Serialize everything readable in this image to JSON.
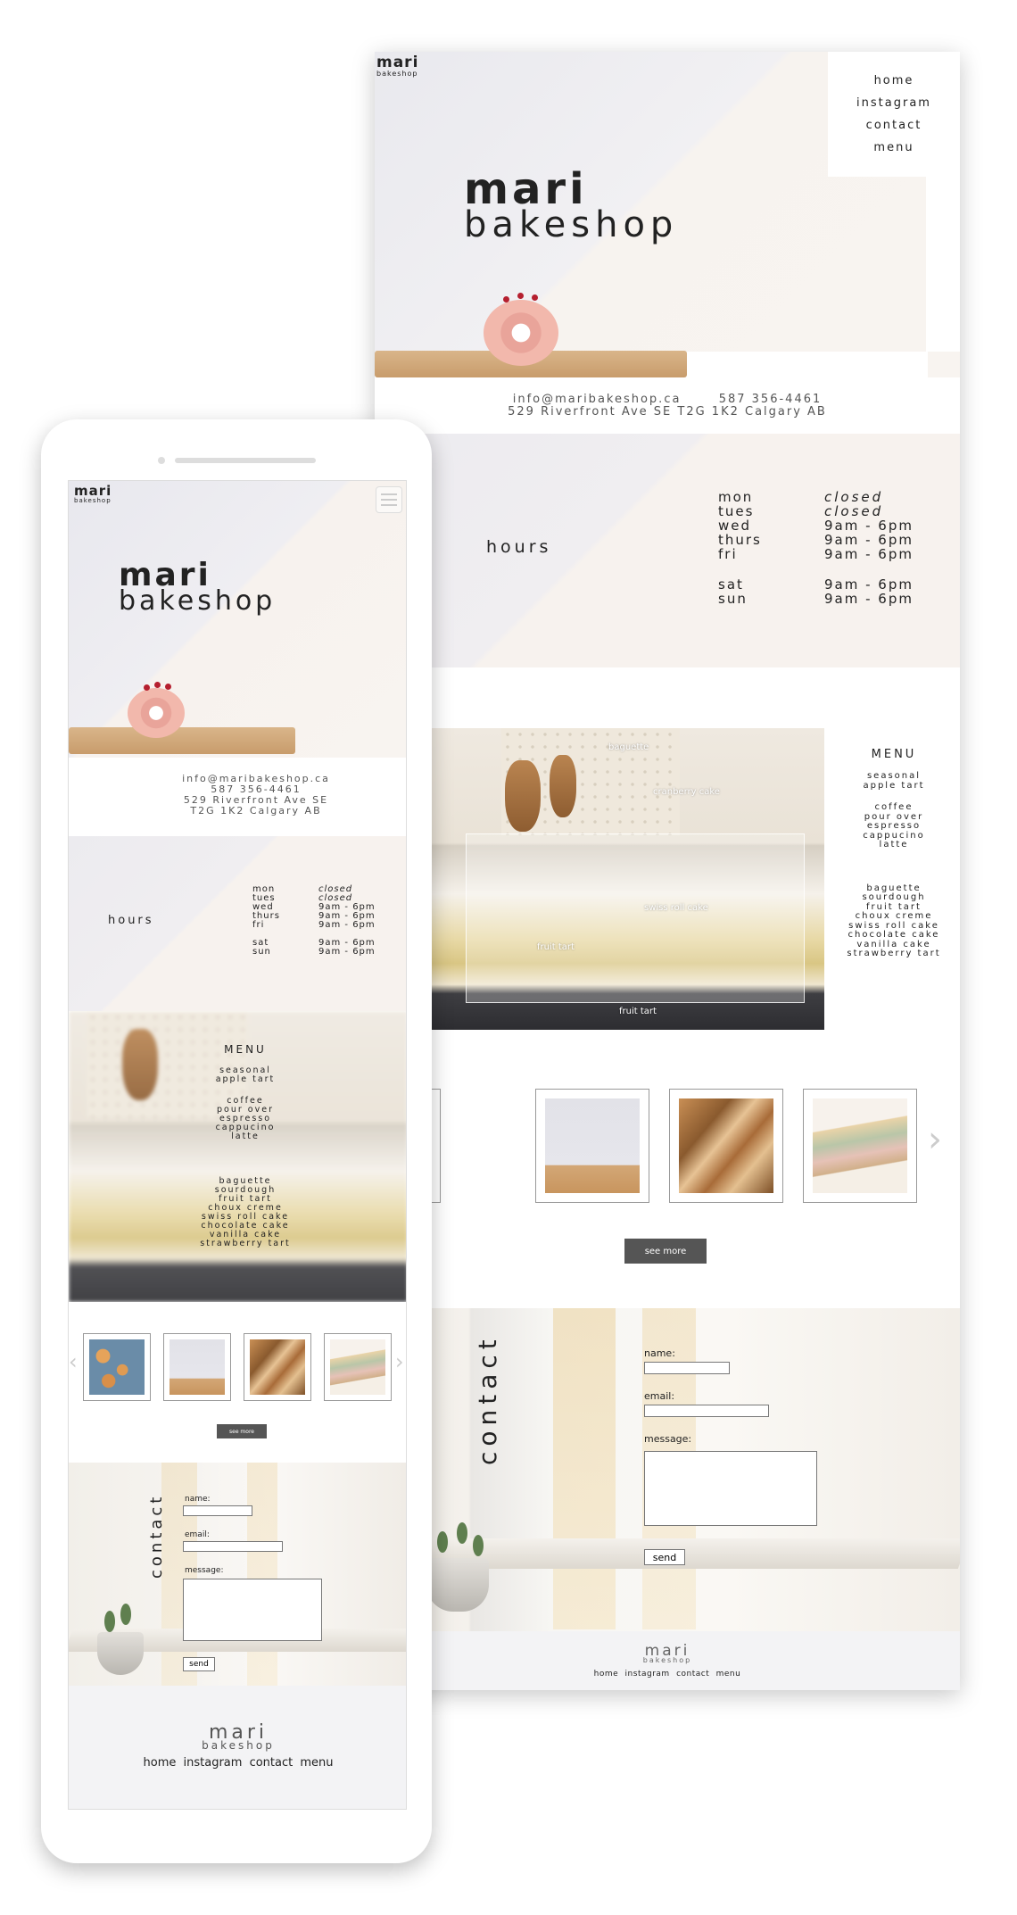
{
  "brand": {
    "name_top": "mari",
    "name_bottom": "bakeshop"
  },
  "nav": [
    "home",
    "instagram",
    "contact",
    "menu"
  ],
  "contact_info": {
    "email": "info@maribakeshop.ca",
    "phone": "587 356-4461",
    "address": "529 Riverfront Ave SE T2G 1K2 Calgary AB",
    "address_line1": "529 Riverfront Ave SE",
    "address_line2": "T2G 1K2 Calgary AB"
  },
  "hours": {
    "title": "hours",
    "rows": [
      {
        "day": "mon",
        "time": "closed"
      },
      {
        "day": "tues",
        "time": "closed"
      },
      {
        "day": "wed",
        "time": "9am - 6pm"
      },
      {
        "day": "thurs",
        "time": "9am - 6pm"
      },
      {
        "day": "fri",
        "time": "9am - 6pm"
      },
      {
        "day": "sat",
        "time": "9am - 6pm"
      },
      {
        "day": "sun",
        "time": "9am - 6pm"
      }
    ]
  },
  "menu": {
    "title": "MENU",
    "seasonal": [
      "seasonal",
      "apple tart"
    ],
    "drinks": [
      "coffee",
      "pour over",
      "espresso",
      "cappucino",
      "latte"
    ],
    "bakery": [
      "baguette",
      "sourdough",
      "fruit tart",
      "choux creme",
      "swiss roll cake",
      "chocolate cake",
      "vanilla cake",
      "strawberry tart"
    ],
    "photo_labels": [
      "baguette",
      "cranberry cake",
      "swiss roll cake",
      "fruit tart",
      "fruit tart"
    ]
  },
  "gallery": {
    "see_more": "see more",
    "next_arrow": "›",
    "prev_arrow": "‹"
  },
  "contact_form": {
    "title": "contact",
    "name_label": "name:",
    "email_label": "email:",
    "message_label": "message:",
    "send_label": "send"
  },
  "icons": {
    "menu": "hamburger-icon",
    "next": "chevron-right-icon",
    "prev": "chevron-left-icon"
  }
}
